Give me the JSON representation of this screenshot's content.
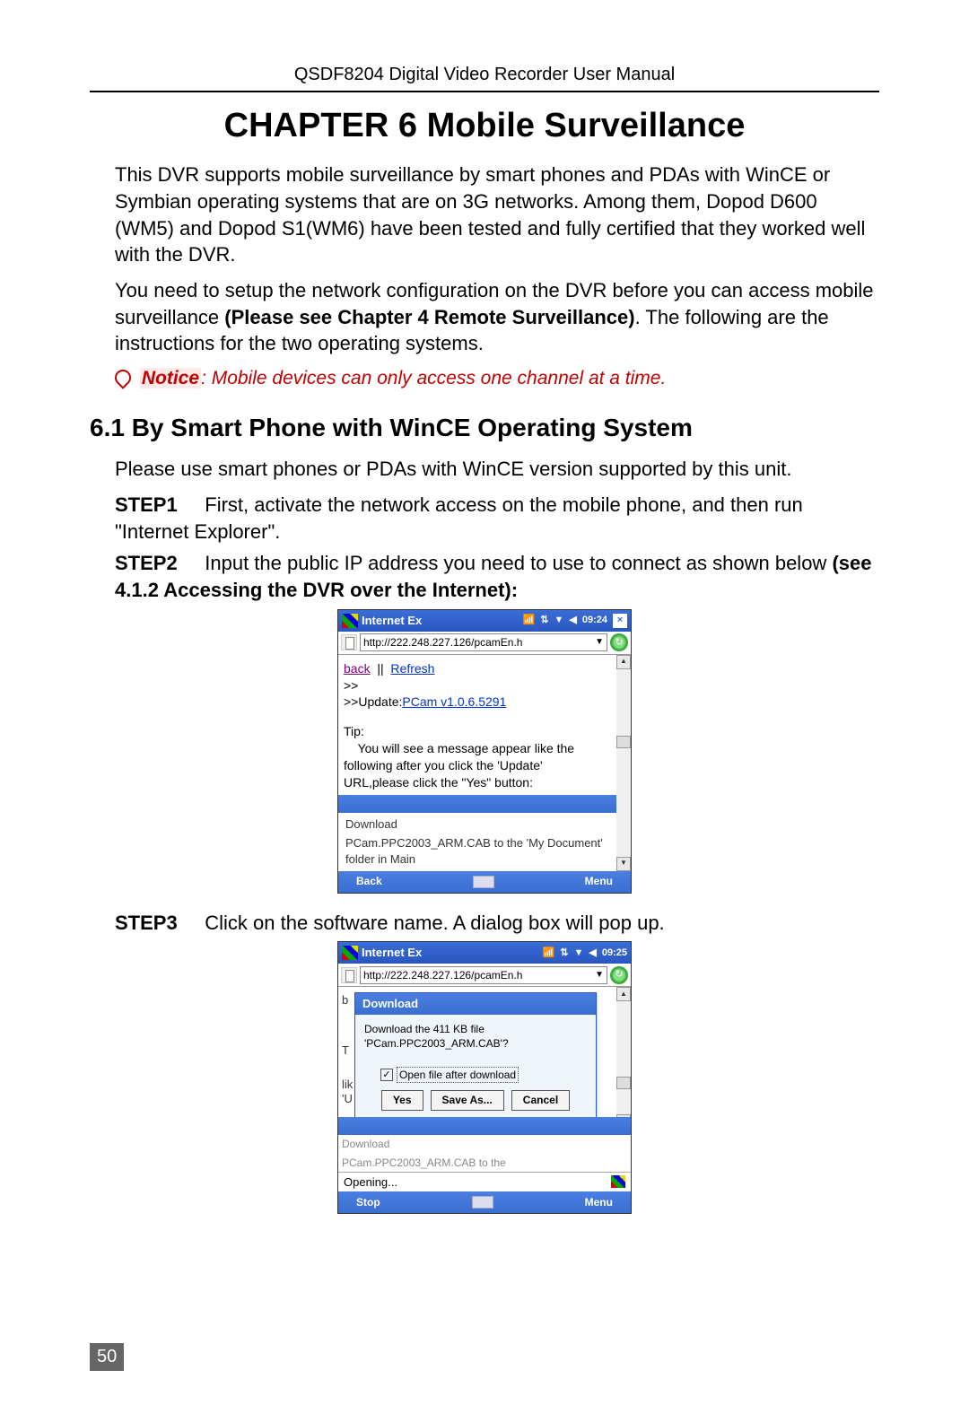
{
  "header": "QSDF8204 Digital Video Recorder User Manual",
  "chapter_title": "CHAPTER 6    Mobile Surveillance",
  "intro": "This DVR supports mobile surveillance by smart phones and PDAs with WinCE or Symbian operating systems that are on 3G networks. Among them, Dopod D600 (WM5) and Dopod S1(WM6) have been tested and fully certified that they worked well with the DVR.",
  "setup_a": "You need to setup the network configuration on the DVR before you can access mobile surveillance ",
  "setup_b": "(Please see Chapter 4 Remote Surveillance)",
  "setup_c": ". The following are the instructions for the two operating systems.",
  "notice_label": "Notice",
  "notice_text": ": Mobile devices can only access one channel at a time.",
  "section_title": "6.1 By Smart Phone with WinCE Operating System",
  "body1": "Please use smart phones or PDAs with WinCE version supported by this unit.",
  "step1_label": "STEP1",
  "step1_text": "First, activate the network access on the mobile phone, and then run \"Internet Explorer\".",
  "step2_label": "STEP2",
  "step2_text_a": "Input the public IP address you need to use to connect as shown below ",
  "step2_text_b": "(see 4.1.2 Accessing the DVR over the Internet):",
  "step3_label": "STEP3",
  "step3_text": "Click on the software name. A dialog box will pop up.",
  "ss1": {
    "title": "Internet Ex",
    "time": "09:24",
    "url": "http://222.248.227.126/pcamEn.h",
    "back": "back",
    "refresh": "Refresh",
    "arrows": ">>",
    "update_prefix": ">>Update:",
    "update_link": "PCam v1.0.6.5291",
    "tip": "Tip:",
    "tip_text": "    You will see a message appear like the following after you click the 'Update' URL,please click the \"Yes\" button:",
    "download": "Download",
    "download_file": "PCam.PPC2003_ARM.CAB to the 'My Document' folder in Main",
    "btn_back": "Back",
    "btn_menu": "Menu"
  },
  "ss2": {
    "title": "Internet Ex",
    "time": "09:25",
    "url": "http://222.248.227.126/pcamEn.h",
    "bg_b": "b",
    "bg_lk": "lik",
    "bg_u": "'U",
    "bg_t": "T",
    "dialog_title": "Download",
    "dialog_msg": "Download the 411 KB file 'PCam.PPC2003_ARM.CAB'?",
    "check_label": "Open file after download",
    "btn_yes": "Yes",
    "btn_save": "Save As...",
    "btn_cancel": "Cancel",
    "dl_text1": "Download",
    "dl_text2": "PCam.PPC2003_ARM.CAB to the",
    "opening": "Opening...",
    "btn_stop": "Stop",
    "btn_menu": "Menu"
  },
  "page_number": "50"
}
